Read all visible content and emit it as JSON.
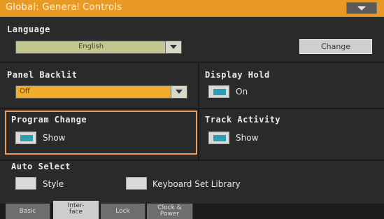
{
  "titlebar": {
    "title": "Global: General Controls"
  },
  "language": {
    "label": "Language",
    "value": "English",
    "change_button": "Change"
  },
  "panel_backlit": {
    "label": "Panel Backlit",
    "value": "Off"
  },
  "display_hold": {
    "label": "Display Hold",
    "checkbox_label": "On",
    "checked": true
  },
  "program_change": {
    "label": "Program Change",
    "checkbox_label": "Show",
    "checked": true
  },
  "track_activity": {
    "label": "Track Activity",
    "checkbox_label": "Show",
    "checked": true
  },
  "auto_select": {
    "label": "Auto Select",
    "style_label": "Style",
    "style_checked": false,
    "keyboard_set_label": "Keyboard Set Library",
    "keyboard_set_checked": false
  },
  "tabs": [
    {
      "line1": "Basic",
      "line2": "",
      "active": false
    },
    {
      "line1": "Inter-",
      "line2": "face",
      "active": true
    },
    {
      "line1": "Lock",
      "line2": "",
      "active": false
    },
    {
      "line1": "Clock &",
      "line2": "Power",
      "active": false
    }
  ],
  "colors": {
    "accent": "#e89a24",
    "check_fill": "#2a9fb0",
    "highlight": "#f39a5a"
  }
}
